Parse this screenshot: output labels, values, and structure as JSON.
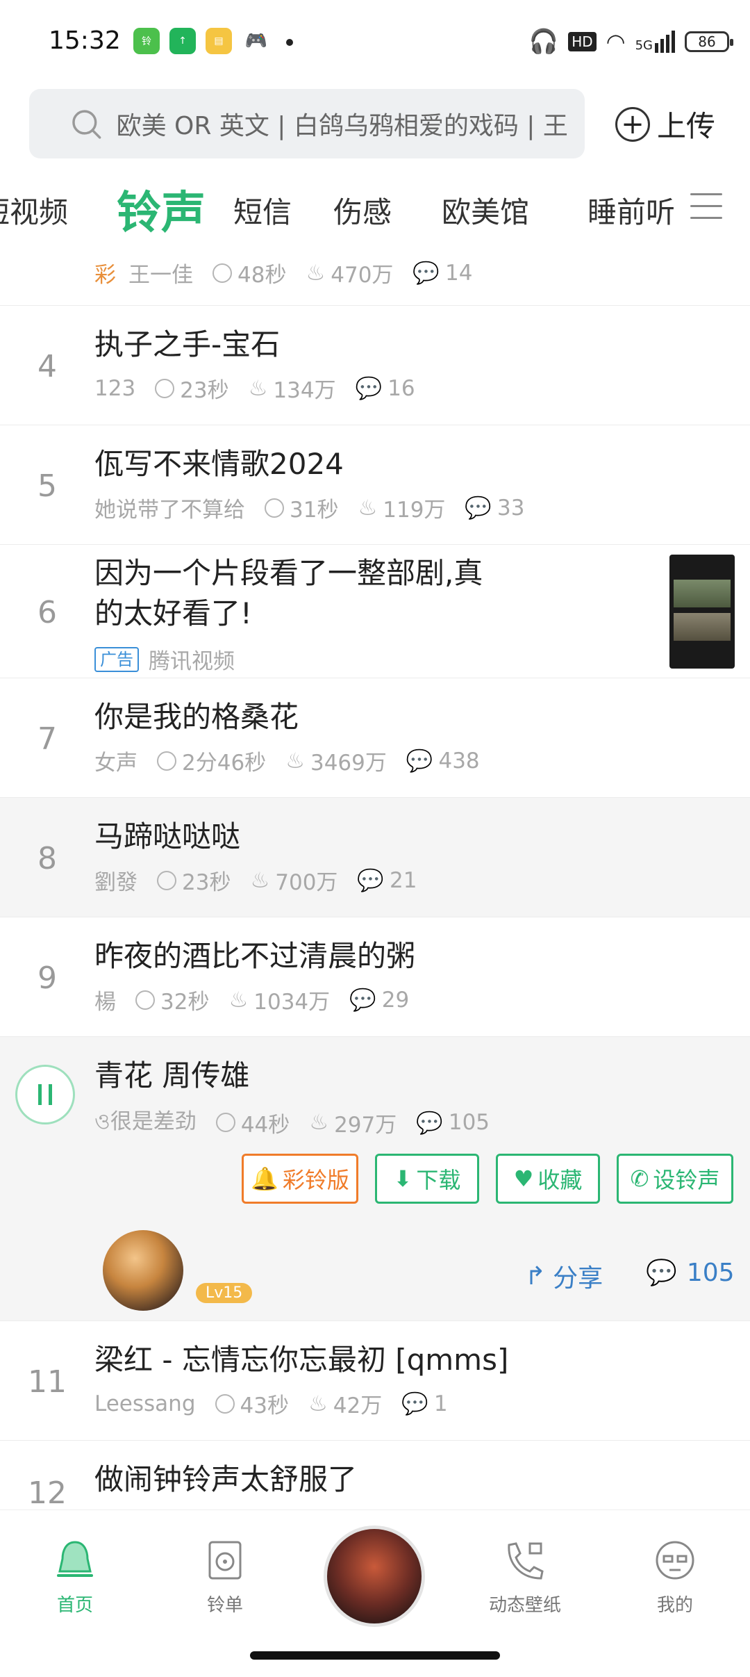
{
  "status": {
    "time": "15:32",
    "battery": "86",
    "network": "5G",
    "hd": "HD"
  },
  "search": {
    "placeholder": "欧美 OR 英文 | 白鸽乌鸦相爱的戏码 | 王",
    "upload_label": "上传"
  },
  "tabs": [
    {
      "label": "短视频"
    },
    {
      "label": "铃声"
    },
    {
      "label": "短信"
    },
    {
      "label": "伤感"
    },
    {
      "label": "欧美馆"
    },
    {
      "label": "睡前听"
    }
  ],
  "partial_row": {
    "prefix": "彩",
    "artist": "王一佳",
    "duration": "48秒",
    "plays": "470万",
    "comments": "14"
  },
  "rows": [
    {
      "rank": "4",
      "title": "执子之手-宝石",
      "artist": "123",
      "duration": "23秒",
      "plays": "134万",
      "comments": "16"
    },
    {
      "rank": "5",
      "title": "佤写不来情歌2024",
      "artist": "她说带了不算给",
      "duration": "31秒",
      "plays": "119万",
      "comments": "33"
    }
  ],
  "ad": {
    "rank": "6",
    "title_line1": "因为一个片段看了一整部剧,真",
    "title_line2": "的太好看了!",
    "tag": "广告",
    "source": "腾讯视频"
  },
  "rows2": [
    {
      "rank": "7",
      "title": "你是我的格桑花",
      "artist": "女声",
      "duration": "2分46秒",
      "plays": "3469万",
      "comments": "438"
    },
    {
      "rank": "8",
      "title": "马蹄哒哒哒",
      "artist": "劉發",
      "duration": "23秒",
      "plays": "700万",
      "comments": "21"
    },
    {
      "rank": "9",
      "title": "昨夜的酒比不过清晨的粥",
      "artist": "楊",
      "duration": "32秒",
      "plays": "1034万",
      "comments": "29"
    }
  ],
  "playing": {
    "title": "青花  周传雄",
    "artist": "ও很是差劲",
    "duration": "44秒",
    "plays": "297万",
    "comments": "105",
    "buttons": {
      "color_ring": "彩铃版",
      "download": "下载",
      "favorite": "收藏",
      "set_ringtone": "设铃声"
    },
    "level": "Lv15",
    "share": "分享",
    "comment_count": "105"
  },
  "rows3": [
    {
      "rank": "11",
      "title": "梁红 - 忘情忘你忘最初 [qmms]",
      "artist": "Leessang",
      "duration": "43秒",
      "plays": "42万",
      "comments": "1"
    },
    {
      "rank": "12",
      "title": "做闹钟铃声太舒服了"
    }
  ],
  "bottom_nav": [
    {
      "label": "首页"
    },
    {
      "label": "铃单"
    },
    {
      "label": "动态壁纸"
    },
    {
      "label": "我的"
    }
  ],
  "colors": {
    "accent": "#2bb673",
    "orange": "#f07c2a",
    "link": "#3a7fc6"
  }
}
